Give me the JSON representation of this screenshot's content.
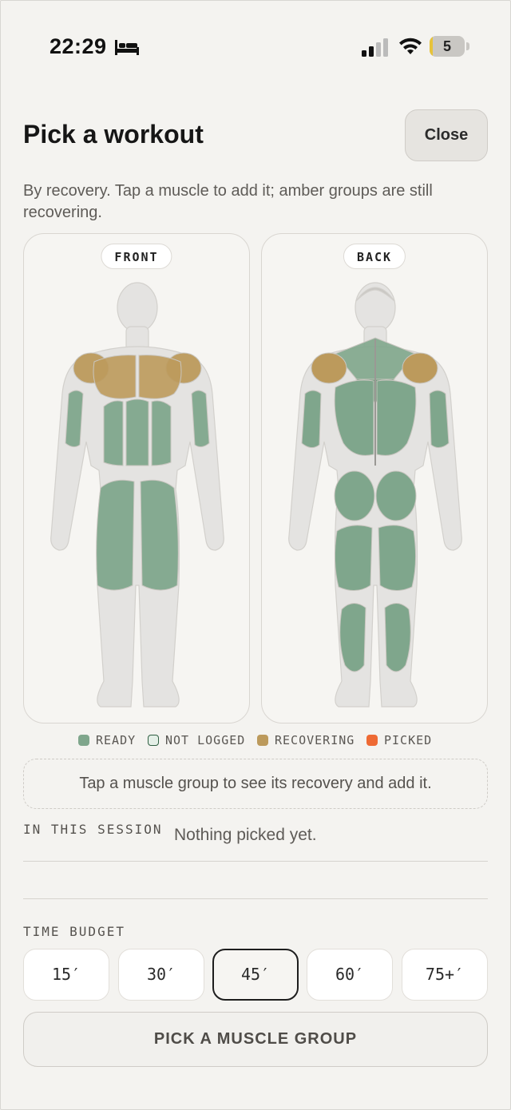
{
  "status_bar": {
    "time": "22:29",
    "battery_level": "5",
    "battery_fraction": 0.05
  },
  "header": {
    "title": "Pick a workout",
    "close_label": "Close",
    "subtitle": "By recovery. Tap a muscle to add it; amber groups are still recovering."
  },
  "body_map": {
    "front_label": "FRONT",
    "back_label": "BACK",
    "colors": {
      "ready": "#7fa68c",
      "not_logged": "#e4efe7",
      "recovering": "#bc9a5c",
      "picked": "#ee6a34",
      "body": "#e4e3e1"
    },
    "front_muscles": [
      {
        "name": "chest",
        "status": "recovering"
      },
      {
        "name": "front-delts",
        "status": "recovering"
      },
      {
        "name": "biceps",
        "status": "ready"
      },
      {
        "name": "abs",
        "status": "ready"
      },
      {
        "name": "quads",
        "status": "ready"
      }
    ],
    "back_muscles": [
      {
        "name": "traps",
        "status": "ready"
      },
      {
        "name": "rear-delts",
        "status": "recovering"
      },
      {
        "name": "lats",
        "status": "ready"
      },
      {
        "name": "triceps",
        "status": "ready"
      },
      {
        "name": "glutes",
        "status": "ready"
      },
      {
        "name": "hamstrings",
        "status": "ready"
      },
      {
        "name": "calves",
        "status": "ready"
      }
    ]
  },
  "legend": [
    {
      "label": "READY",
      "color": "#7fa68c"
    },
    {
      "label": "NOT LOGGED",
      "color": "#e4efe7"
    },
    {
      "label": "RECOVERING",
      "color": "#bc9a5c"
    },
    {
      "label": "PICKED",
      "color": "#ee6a34"
    }
  ],
  "hint": "Tap a muscle group to see its recovery and add it.",
  "session": {
    "label": "IN THIS SESSION",
    "value": "Nothing picked yet."
  },
  "time_budget": {
    "label": "TIME BUDGET",
    "options": [
      "15′",
      "30′",
      "45′",
      "60′",
      "75+′"
    ],
    "selected": "45′"
  },
  "primary_action": "PICK A MUSCLE GROUP"
}
